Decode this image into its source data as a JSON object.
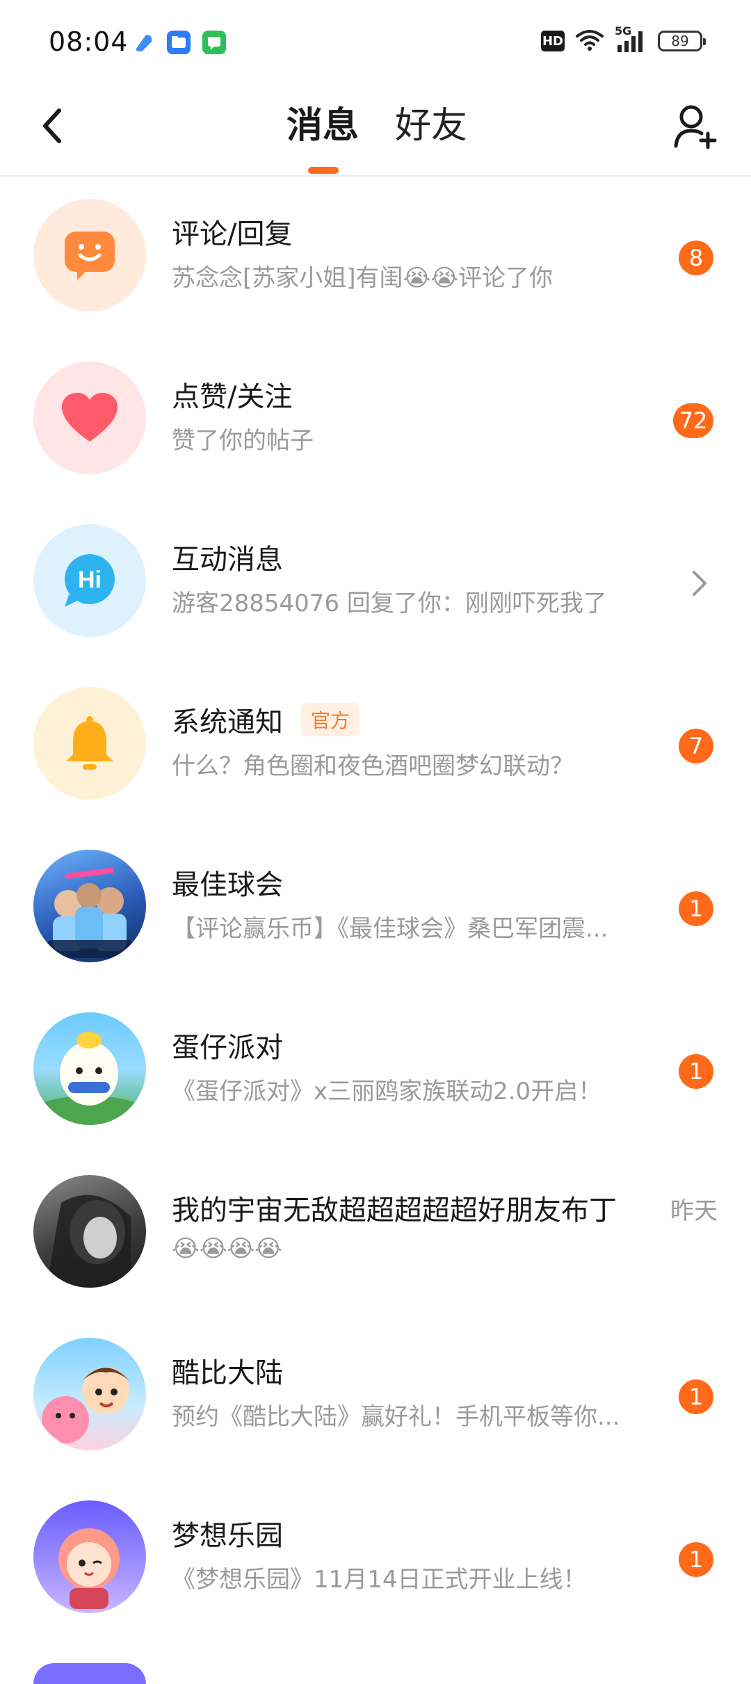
{
  "status_bar": {
    "time": "08:04",
    "hd_label": "HD",
    "network_label": "5G",
    "battery_level": "89"
  },
  "header": {
    "tabs": [
      {
        "label": "消息",
        "active": true
      },
      {
        "label": "好友",
        "active": false
      }
    ],
    "back_icon": "chevron-left-icon",
    "add_friend_icon": "add-person-icon"
  },
  "messages": [
    {
      "title": "评论/回复",
      "subtitle": "苏念念[苏家小姐]有闺😭😭评论了你",
      "badge": "8",
      "avatar_icon": "comment-smile-icon"
    },
    {
      "title": "点赞/关注",
      "subtitle": "赞了你的帖子",
      "badge": "72",
      "avatar_icon": "heart-icon"
    },
    {
      "title": "互动消息",
      "subtitle": "游客28854076 回复了你：刚刚吓死我了",
      "avatar_icon": "hi-bubble-icon"
    },
    {
      "title": "系统通知",
      "tag": "官方",
      "subtitle": "什么？角色圈和夜色酒吧圈梦幻联动？",
      "badge": "7",
      "avatar_icon": "bell-icon"
    },
    {
      "title": "最佳球会",
      "subtitle": "【评论赢乐币】《最佳球会》桑巴军团震...",
      "badge": "1"
    },
    {
      "title": "蛋仔派对",
      "subtitle": "《蛋仔派对》x三丽鸥家族联动2.0开启！",
      "badge": "1"
    },
    {
      "title": "我的宇宙无敌超超超超超好朋友布丁",
      "time": "昨天",
      "subtitle": "😭😭😭😭"
    },
    {
      "title": "酷比大陆",
      "subtitle": "预约《酷比大陆》赢好礼！手机平板等你...",
      "badge": "1"
    },
    {
      "title": "梦想乐园",
      "subtitle": "《梦想乐园》11月14日正式开业上线！",
      "badge": "1"
    }
  ],
  "colors": {
    "accent": "#ff6a1a",
    "subtitle_gray": "#9a9a9a"
  }
}
